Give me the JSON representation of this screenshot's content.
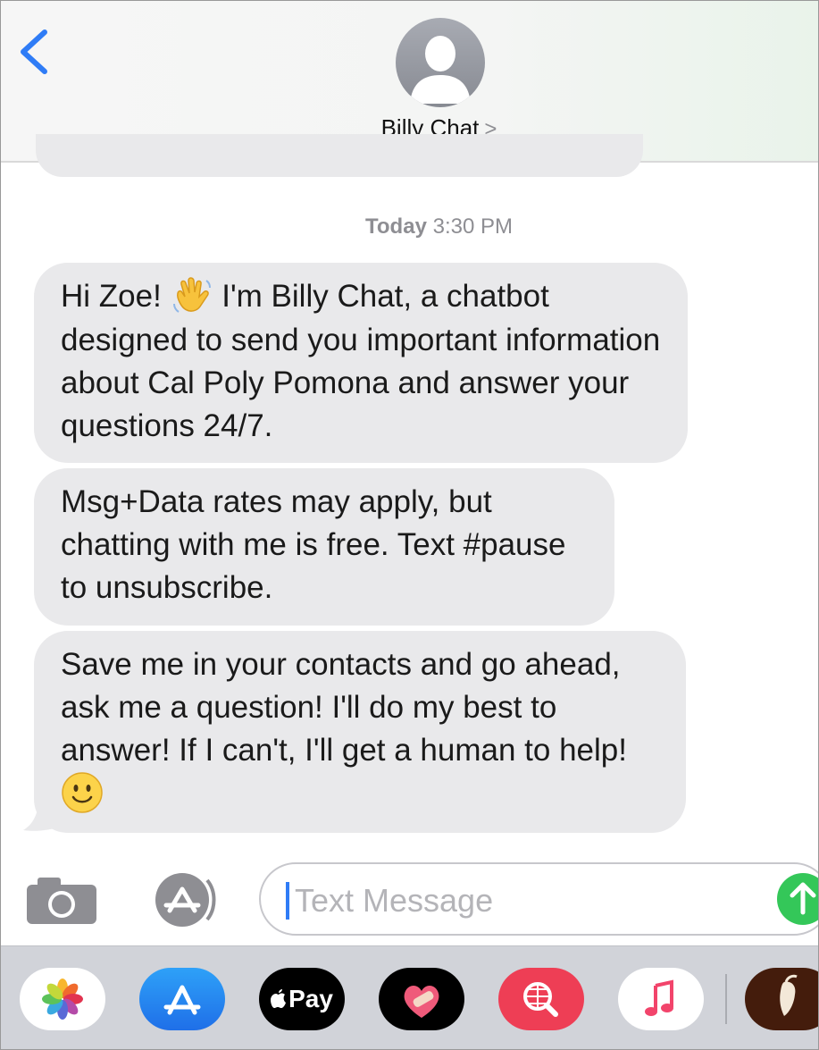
{
  "header": {
    "back_icon": "chevron-left-icon",
    "avatar_icon": "person-silhouette-icon",
    "contact_name": "Billy Chat",
    "contact_chevron": ">"
  },
  "timestamp": {
    "day": "Today",
    "time": "3:30 PM"
  },
  "messages": [
    {
      "text_before_emoji": "Hi Zoe! ",
      "emoji": "waving-hand-emoji",
      "text_after_emoji": " I'm Billy Chat, a chatbot designed to send you important information about Cal Poly Pomona and answer your questions 24/7."
    },
    {
      "text": "Msg+Data rates may apply, but chatting with me is free. Text #pause to unsubscribe."
    },
    {
      "text": "Save me in your contacts and go ahead, ask me a question! I'll do my best to answer! If I can't, I'll get a human to help! ",
      "emoji": "smiling-face-emoji"
    }
  ],
  "composer": {
    "placeholder": "Text Message",
    "camera_icon": "camera-icon",
    "apps_icon": "app-store-icon",
    "send_icon": "arrow-up-icon"
  },
  "app_drawer": {
    "apps": [
      {
        "name": "photos-app-icon"
      },
      {
        "name": "app-store-app-icon"
      },
      {
        "name": "apple-pay-app-icon",
        "label": "Pay"
      },
      {
        "name": "heart-stickers-app-icon"
      },
      {
        "name": "image-search-app-icon"
      },
      {
        "name": "music-app-icon"
      },
      {
        "name": "pepper-app-icon"
      }
    ]
  },
  "colors": {
    "accent": "#2f7cf6",
    "bubble": "#e9e9eb",
    "send": "#34c759",
    "drawer": "#d1d3d9"
  }
}
